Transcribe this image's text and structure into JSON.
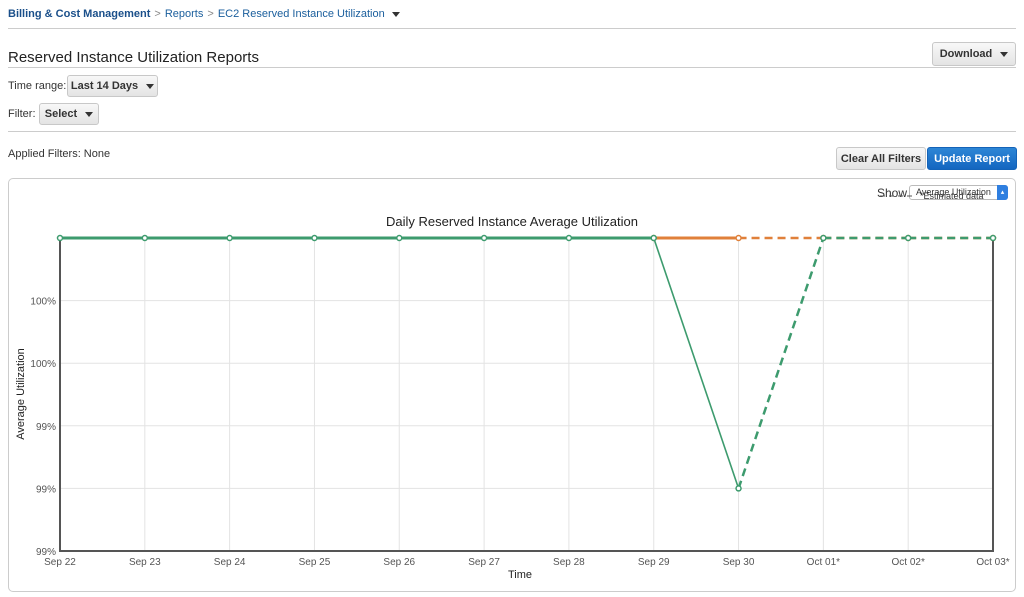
{
  "breadcrumb": {
    "root": "Billing & Cost Management",
    "reports": "Reports",
    "current": "EC2 Reserved Instance Utilization"
  },
  "page_title": "Reserved Instance Utilization Reports",
  "download_label": "Download",
  "time_range": {
    "label": "Time range:",
    "value": "Last 14 Days"
  },
  "filter": {
    "label": "Filter:",
    "value": "Select"
  },
  "applied_filters": "Applied Filters: None",
  "clear_label": "Clear All Filters",
  "update_label": "Update Report",
  "show": {
    "label": "Show",
    "value": "Average Utilization"
  },
  "colors": {
    "accent": "#1466c0",
    "green": "#3d9b6e",
    "orange": "#e0803a"
  },
  "chart_data": {
    "type": "line",
    "title": "Daily Reserved Instance Average Utilization",
    "xlabel": "Time",
    "ylabel": "Average Utilization",
    "legend": {
      "label": "*Estimated data",
      "placement": "top-right"
    },
    "categories": [
      "Sep 22",
      "Sep 23",
      "Sep 24",
      "Sep 25",
      "Sep 26",
      "Sep 27",
      "Sep 28",
      "Sep 29",
      "Sep 30",
      "Oct 01*",
      "Oct 02*",
      "Oct 03*"
    ],
    "ylim": [
      99.0,
      100.0
    ],
    "yticks": [
      {
        "v": 99.0,
        "label": "99%"
      },
      {
        "v": 99.2,
        "label": "99%"
      },
      {
        "v": 99.4,
        "label": "99%"
      },
      {
        "v": 99.6,
        "label": "100%"
      },
      {
        "v": 99.8,
        "label": "100%"
      }
    ],
    "grid": true,
    "series": [
      {
        "color": "#e0803a",
        "values": [
          null,
          null,
          null,
          null,
          null,
          null,
          null,
          100,
          100,
          100,
          100,
          100
        ],
        "estimated_from": 8
      },
      {
        "color": "#3d9b6e",
        "values": [
          100,
          100,
          100,
          100,
          100,
          100,
          100,
          100,
          99.2,
          100,
          100,
          100
        ],
        "estimated_from": 8
      }
    ]
  }
}
